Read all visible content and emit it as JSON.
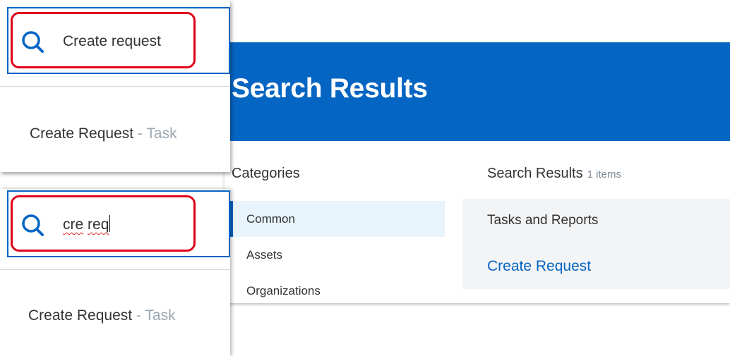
{
  "colors": {
    "header_blue": "#0565c3",
    "highlight_red": "#e0001b",
    "link_blue": "#0565c3",
    "muted_gray": "#9aa7b2"
  },
  "search_results_page": {
    "title": "Search Results",
    "categories": {
      "heading": "Categories",
      "items": [
        {
          "label": "Common",
          "active": true
        },
        {
          "label": "Assets",
          "active": false
        },
        {
          "label": "Organizations",
          "active": false
        }
      ]
    },
    "results": {
      "heading": "Search Results",
      "count_text": "1 items",
      "group_heading": "Tasks and Reports",
      "items": [
        {
          "label": "Create Request"
        }
      ]
    }
  },
  "search_dropdowns": [
    {
      "query": "Create request",
      "suggestion": {
        "name": "Create Request",
        "separator": " - ",
        "type": "Task"
      }
    },
    {
      "query_words": [
        "cre",
        "req"
      ],
      "suggestion": {
        "name": "Create Request",
        "separator": " - ",
        "type": "Task"
      }
    }
  ],
  "icons": {
    "search": "search-icon"
  }
}
